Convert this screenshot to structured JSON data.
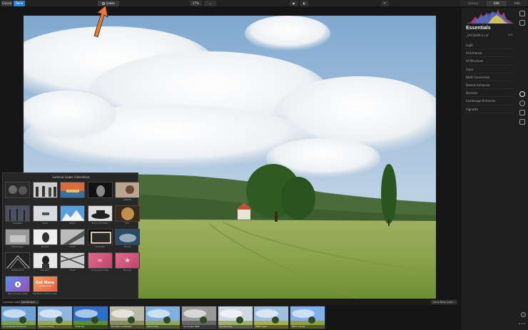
{
  "toolbar": {
    "cancel": "Cancel",
    "done": "Done",
    "looks": "Looks",
    "zoom": "27%",
    "zoom_dd": "⌄",
    "library": "Library",
    "edit": "Edit",
    "info": "Info"
  },
  "panel": {
    "title": "Essentials",
    "filename": "_DSC8486-2.raf",
    "filename_action": "Edit",
    "filters": [
      "Light",
      "AI Enhance",
      "AI Structure",
      "Color",
      "B&W Conversion",
      "Details Enhancer",
      "Denoise",
      "Landscape Enhancer",
      "Vignette"
    ],
    "help": "?"
  },
  "looks_popover": {
    "title": "Luminar Looks Collections",
    "collections": [
      {
        "name": "",
        "style": "dark-portrait"
      },
      {
        "name": "",
        "style": "bw-people"
      },
      {
        "name": "",
        "style": "boats"
      },
      {
        "name": "",
        "style": "face-dark"
      },
      {
        "name": "Lifestyle",
        "style": "lifestyle"
      },
      {
        "name": "Dramatic",
        "style": "dramatic"
      },
      {
        "name": "Aerial",
        "style": "aerial"
      },
      {
        "name": "Winter",
        "style": "winter"
      },
      {
        "name": "Black and White",
        "style": "hat"
      },
      {
        "name": "Film",
        "style": "film"
      },
      {
        "name": "Street Style",
        "style": "street"
      },
      {
        "name": "Portrait",
        "style": "portrait"
      },
      {
        "name": "Urban",
        "style": "urban"
      },
      {
        "name": "Cinematic",
        "style": "cinematic"
      },
      {
        "name": "Moody",
        "style": "moody"
      },
      {
        "name": "Architecture",
        "style": "architecture"
      },
      {
        "name": "Film Noir",
        "style": "noir"
      },
      {
        "name": "Travel",
        "style": "travel"
      },
      {
        "name": "All Luminar Looks",
        "style": "pink"
      },
      {
        "name": "Favorite",
        "style": "pink-star"
      },
      {
        "name": "User Luminar Looks",
        "style": "purple"
      },
      {
        "name": "Get More Luminar Looks",
        "style": "orange"
      }
    ],
    "get_more": "Get More",
    "get_more_sub": "Luminar Looks"
  },
  "filmstrip": {
    "tab1": "Luminar Looks",
    "tab2": "Landscape",
    "tab2_arrow": "⌄",
    "save_button": "Save New Look...",
    "looks": [
      "AI Landscape Enhancer",
      "Autumn Colors",
      "Deep Sky",
      "Dramatic Landscape",
      "Harmonize",
      "Landscape B&W",
      "Morning Fog",
      "Warm Land",
      "Warm Sunset"
    ]
  },
  "colors": {
    "accent": "#2f7fd8",
    "annotation_arrow": "#f07a2a",
    "panel_bg": "#1e1e1e"
  }
}
